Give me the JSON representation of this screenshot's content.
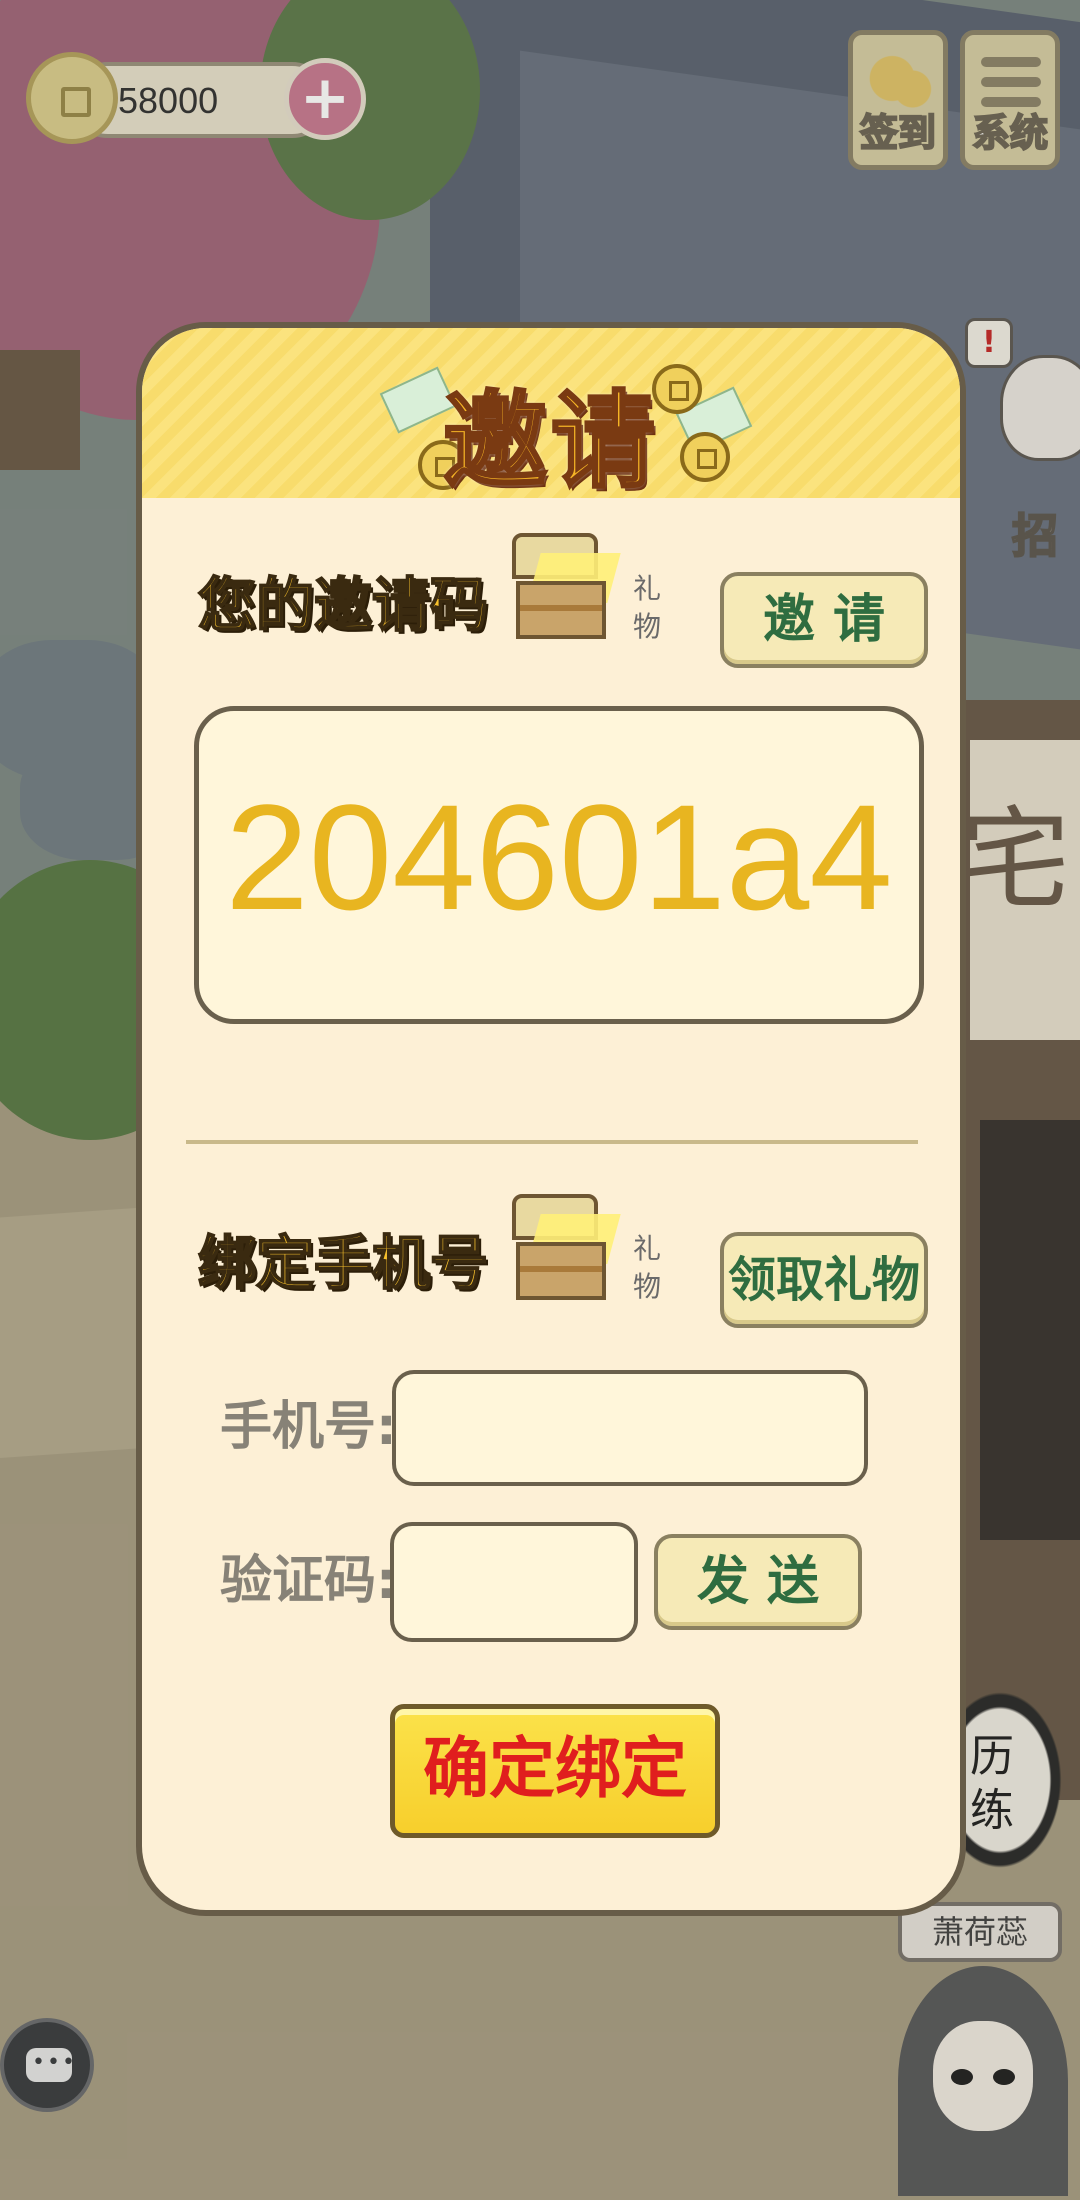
{
  "hud": {
    "coin_amount": "58000",
    "plus_symbol": "+",
    "signin_label": "签到",
    "system_label": "系统"
  },
  "background": {
    "notice_mark": "!",
    "side_label": "招",
    "sign_char": "宅"
  },
  "dialog": {
    "title": "邀请",
    "invite_section": {
      "title": "您的邀请码",
      "gift_label": "礼物",
      "invite_button": "邀 请",
      "invite_code": "204601a4"
    },
    "bind_section": {
      "title": "绑定手机号",
      "gift_label": "礼物",
      "claim_button": "领取礼物",
      "phone_label": "手机号:",
      "phone_value": "",
      "code_label": "验证码:",
      "code_value": "",
      "send_button": "发 送",
      "confirm_button": "确定绑定"
    }
  },
  "bottom": {
    "ink_label": "历练",
    "name_tag": "萧荷蕊"
  },
  "colors": {
    "dialog_bg": "#fdf0d6",
    "header_yellow": "#fbe37e",
    "code_color": "#e8b520",
    "confirm_text": "#e01e1e",
    "button_text_green": "#2f6d40"
  }
}
